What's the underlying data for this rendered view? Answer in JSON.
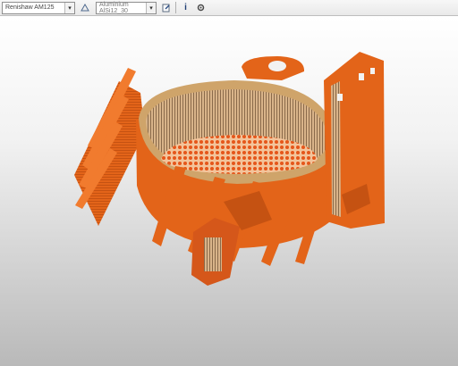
{
  "toolbar": {
    "machine_select": {
      "value": "Renishaw AM125"
    },
    "material_select": {
      "value": "Aluminium AlSi12_30"
    },
    "icons": [
      "edit-icon",
      "info-icon",
      "settings-icon"
    ]
  },
  "colors": {
    "part_orange": "#e36419",
    "part_dark": "#b44710",
    "ring_tan": "#cfa46a",
    "viewport_top": "#ffffff",
    "viewport_bottom": "#b9b9b9"
  }
}
